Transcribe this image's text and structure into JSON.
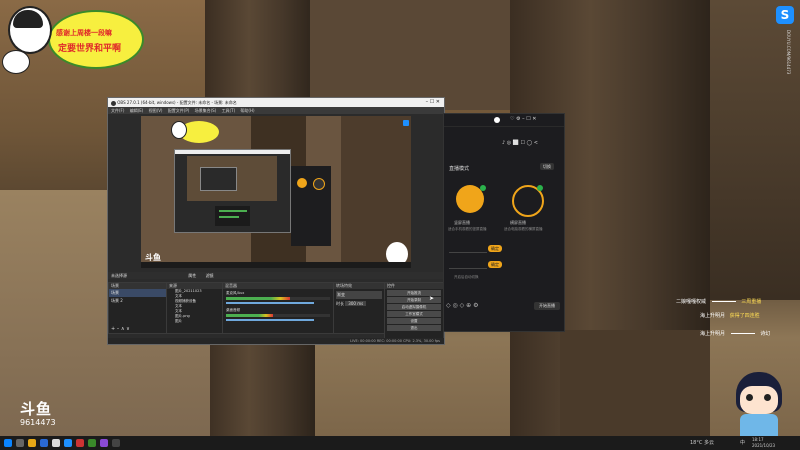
{
  "banner": {
    "line1": "感谢上周楼一段嘛",
    "line2": "定要世界和平啊"
  },
  "watermark": {
    "logo": "斗鱼",
    "room_id": "9614473"
  },
  "side_text": "DOUYU.COM/9614473",
  "obs": {
    "title": "OBS 27.0.1 (64-bit, windows) - 配置文件: 未命名 - 场景: 未命名",
    "menu": [
      "文件(F)",
      "编辑(E)",
      "视图(V)",
      "配置文件(P)",
      "场景集合(S)",
      "工具(T)",
      "帮助(H)"
    ],
    "no_source_label": "未选择源",
    "properties": "属性",
    "filters": "滤镜",
    "docks": {
      "scenes": "场景",
      "sources": "来源",
      "mixer": "混音器",
      "transitions": "转场特效",
      "controls": "控件"
    },
    "scenes": [
      "场景",
      "场景 2"
    ],
    "sources": [
      "图片_20211023",
      "文本",
      "视频捕获设备",
      "文本",
      "文本",
      "图片.png",
      "图片"
    ],
    "mixer": [
      {
        "name": "麦克风/Aux",
        "level": 0.62
      },
      {
        "name": "桌面音频",
        "level": 0.45
      }
    ],
    "transition": {
      "type": "渐变",
      "duration_label": "时长",
      "duration": "300 ms"
    },
    "controls": [
      "开始推流",
      "开始录制",
      "启动虚拟摄像机",
      "工作室模式",
      "设置",
      "退出"
    ],
    "status": "LIVE: 00:00:00   REC: 00:00:00   CPU: 2.3%, 30.00 fps"
  },
  "panel": {
    "mode_label": "直播模式",
    "toggle_label": "切换",
    "option1": "竖屏直播",
    "option1_desc": "适合手机观看的竖屏直播",
    "option2": "横屏直播",
    "option2_desc": "适合电脑观看的横屏直播",
    "btn1": "确定",
    "btn2": "确定",
    "hint": "开启后自动切换",
    "start": "开始直播"
  },
  "chat": [
    {
      "user": "二娘嘎嘎权威",
      "text": "三周重播",
      "color": "#ffdd55"
    },
    {
      "user": "海上升明月",
      "text": "获得了四连胜",
      "color": "#ffdd55"
    },
    {
      "user": "海上升明月",
      "text": "诗幻",
      "color": "#ffffff"
    }
  ],
  "taskbar": {
    "weather": "18°C 多云",
    "lang": "中",
    "time": "18:17",
    "date": "2021/10/23"
  },
  "colors": {
    "accent": "#f0a51a",
    "obs_bg": "#2b2b2b",
    "panel_bg": "#1c1c1f"
  }
}
